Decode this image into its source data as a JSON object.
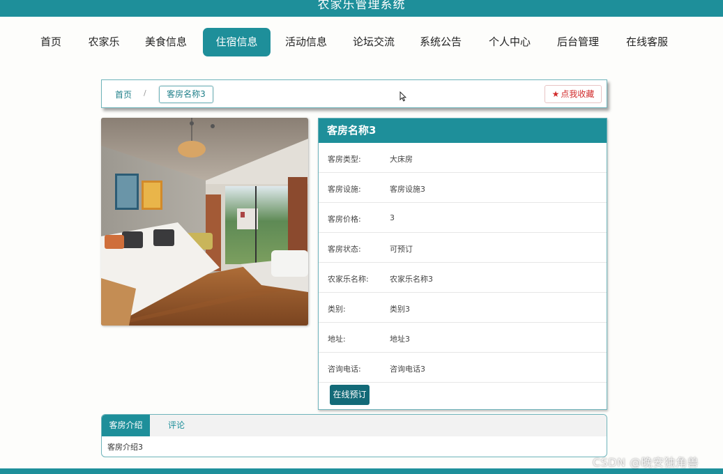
{
  "header": {
    "site_title": "农家乐管理系统"
  },
  "nav": {
    "items": [
      {
        "label": "首页"
      },
      {
        "label": "农家乐"
      },
      {
        "label": "美食信息"
      },
      {
        "label": "住宿信息"
      },
      {
        "label": "活动信息"
      },
      {
        "label": "论坛交流"
      },
      {
        "label": "系统公告"
      },
      {
        "label": "个人中心"
      },
      {
        "label": "后台管理"
      },
      {
        "label": "在线客服"
      }
    ],
    "active": "住宿信息"
  },
  "breadcrumb": {
    "home": "首页",
    "separator": "/",
    "current": "客房名称3"
  },
  "favorite": {
    "icon": "star-icon",
    "label": "点我收藏"
  },
  "detail": {
    "title": "客房名称3",
    "rows": [
      {
        "label": "客房类型:",
        "value": "大床房"
      },
      {
        "label": "客房设施:",
        "value": "客房设施3"
      },
      {
        "label": "客房价格:",
        "value": "3"
      },
      {
        "label": "客房状态:",
        "value": "可预订"
      },
      {
        "label": "农家乐名称:",
        "value": "农家乐名称3"
      },
      {
        "label": "类别:",
        "value": "类别3"
      },
      {
        "label": "地址:",
        "value": "地址3"
      },
      {
        "label": "咨询电话:",
        "value": "咨询电话3"
      }
    ],
    "book_label": "在线预订"
  },
  "tabs": {
    "items": [
      {
        "label": "客房介绍"
      },
      {
        "label": "评论"
      }
    ],
    "content": "客房介绍3"
  },
  "watermark": "CSDN @晚安独角兽",
  "colors": {
    "accent": "#1e8f9a",
    "button_dark": "#136a78",
    "favorite": "#d12b2b"
  }
}
